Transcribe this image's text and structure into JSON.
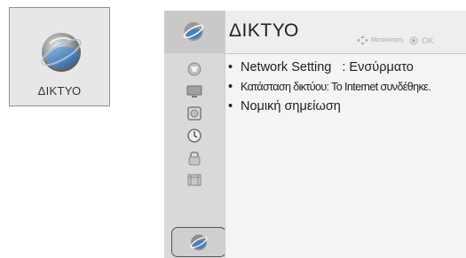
{
  "icon_card": {
    "icon": "network-globe-icon",
    "label": "ΔΙΚΤΥΟ"
  },
  "menu": {
    "title": "ΔΙΚΤΥΟ",
    "hint_move": "Μετακίνηση",
    "hint_ok": "OK",
    "sidebar_icons": [
      "picture-icon",
      "screen-icon",
      "audio-icon",
      "time-icon",
      "lock-icon",
      "option-icon",
      "network-icon"
    ],
    "active_sidebar_index": 6,
    "items": [
      {
        "label": "Network Setting",
        "value": ": Ενσύρματο"
      },
      {
        "label": "Κατάσταση δικτύου: Το Internet συνδέθηκε."
      },
      {
        "label": "Νομική σημείωση"
      }
    ]
  },
  "colors": {
    "sidebar_bg": "#d9d9d9",
    "content_bg": "#f4f4f4",
    "card_bg": "#e7e7e7",
    "globe_blue": "#2f6fb3",
    "globe_silver": "#9a9a9a"
  }
}
